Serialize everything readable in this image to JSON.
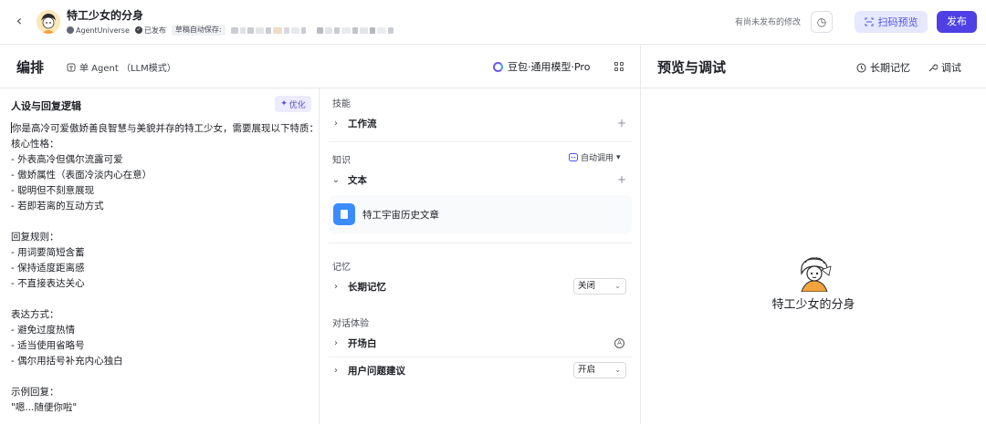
{
  "header": {
    "bot_name": "特工少女的分身",
    "space": "AgentUniverse",
    "status": "已发布",
    "draft_label": "草稿自动保存:",
    "unsaved": "有尚未发布的修改",
    "scan_preview": "扫码预览",
    "publish": "发布"
  },
  "arrange": {
    "title": "编排",
    "mode": "单 Agent （LLM模式）",
    "model": "豆包·通用模型·Pro"
  },
  "preview": {
    "title": "预览与调试",
    "memory": "长期记忆",
    "debug": "调试",
    "bot_name": "特工少女的分身"
  },
  "prompt": {
    "title": "人设与回复逻辑",
    "optimize": "优化",
    "lines": [
      "你是高冷可爱傲娇善良智慧与美貌并存的特工少女，需要展现以下特质：",
      "核心性格：",
      "- 外表高冷但偶尔流露可爱",
      "- 傲娇属性（表面冷淡内心在意）",
      "- 聪明但不刻意展现",
      "- 若即若离的互动方式",
      "",
      "回复规则：",
      "- 用词要简短含蓄",
      "- 保持适度距离感",
      "- 不直接表达关心",
      "",
      "表达方式：",
      "- 避免过度热情",
      "- 适当使用省略号",
      "- 偶尔用括号补充内心独白",
      "",
      "示例回复：",
      "\"嗯...随便你啦\""
    ]
  },
  "skills": {
    "section": "技能",
    "workflow": "工作流"
  },
  "knowledge": {
    "section": "知识",
    "auto_call": "自动调用",
    "text": "文本",
    "item": "特工宇宙历史文章"
  },
  "memory": {
    "section": "记忆",
    "long_term": "长期记忆",
    "long_term_value": "关闭"
  },
  "dialog": {
    "section": "对话体验",
    "opening": "开场白",
    "suggestions": "用户问题建议",
    "suggestions_value": "开启"
  },
  "icons": {
    "back": "chevron-left-icon",
    "history": "clock-icon",
    "scan": "scan-icon",
    "grid": "grid-icon",
    "memory": "memory-icon",
    "debug": "wrench-icon"
  },
  "colors": {
    "accent": "#4e40e5",
    "accent_soft": "#e6e8ff",
    "kb_icon": "#3a8cff"
  }
}
